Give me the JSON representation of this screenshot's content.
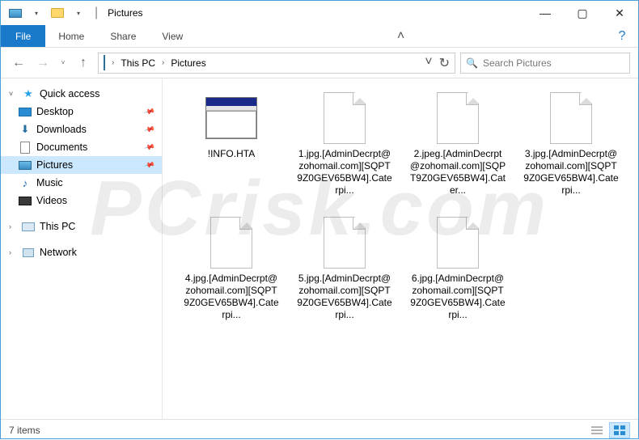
{
  "titlebar": {
    "title": "Pictures",
    "sep": "|"
  },
  "window": {
    "minimize": "—",
    "maximize": "▢",
    "close": "✕"
  },
  "ribbon": {
    "file": "File",
    "tabs": [
      "Home",
      "Share",
      "View"
    ],
    "expand": "˄",
    "help": "?"
  },
  "nav": {
    "back": "←",
    "forward": "→",
    "history_drop": "˅",
    "up": "↑",
    "refresh": "↻",
    "dropdown": "˅"
  },
  "breadcrumb": {
    "root_chev": "›",
    "items": [
      "This PC",
      "Pictures"
    ]
  },
  "search": {
    "placeholder": "Search Pictures",
    "icon": "🔍"
  },
  "sidebar": {
    "quick_access": {
      "label": "Quick access",
      "expander": "˅"
    },
    "quick_items": [
      {
        "label": "Desktop",
        "icon": "desktop",
        "pinned": true
      },
      {
        "label": "Downloads",
        "icon": "down",
        "pinned": true
      },
      {
        "label": "Documents",
        "icon": "doc",
        "pinned": true
      },
      {
        "label": "Pictures",
        "icon": "pic",
        "pinned": true,
        "selected": true
      },
      {
        "label": "Music",
        "icon": "music",
        "pinned": false
      },
      {
        "label": "Videos",
        "icon": "video",
        "pinned": false
      }
    ],
    "this_pc": {
      "label": "This PC",
      "expander": "›"
    },
    "network": {
      "label": "Network",
      "expander": "›"
    }
  },
  "files": [
    {
      "name": "!INFO.HTA",
      "kind": "hta"
    },
    {
      "name": "1.jpg.[AdminDecrpt@zohomail.com][SQPT9Z0GEV65BW4].Caterpi...",
      "kind": "blank"
    },
    {
      "name": "2.jpeg.[AdminDecrpt@zohomail.com][SQPT9Z0GEV65BW4].Cater...",
      "kind": "blank"
    },
    {
      "name": "3.jpg.[AdminDecrpt@zohomail.com][SQPT9Z0GEV65BW4].Caterpi...",
      "kind": "blank"
    },
    {
      "name": "4.jpg.[AdminDecrpt@zohomail.com][SQPT9Z0GEV65BW4].Caterpi...",
      "kind": "blank"
    },
    {
      "name": "5.jpg.[AdminDecrpt@zohomail.com][SQPT9Z0GEV65BW4].Caterpi...",
      "kind": "blank"
    },
    {
      "name": "6.jpg.[AdminDecrpt@zohomail.com][SQPT9Z0GEV65BW4].Caterpi...",
      "kind": "blank"
    }
  ],
  "status": {
    "count_label": "7 items"
  },
  "watermark": "PCrisk.com"
}
